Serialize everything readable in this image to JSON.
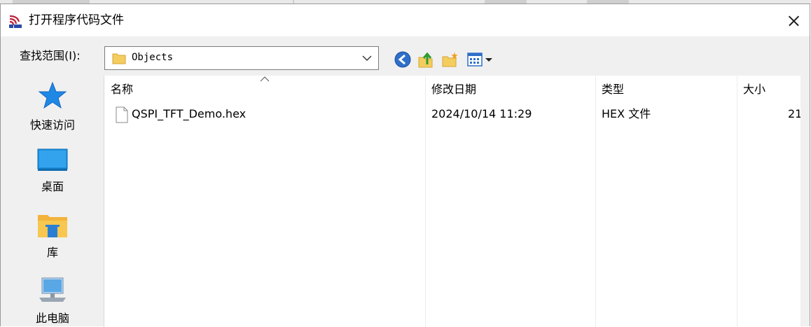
{
  "dialog": {
    "title": "打开程序代码文件"
  },
  "lookin": {
    "label": "查找范围(I):",
    "value": "Objects"
  },
  "toolbar": {
    "icons": [
      "back-icon",
      "up-folder-icon",
      "new-folder-icon",
      "view-menu-icon"
    ]
  },
  "places": [
    {
      "label": "快速访问",
      "icon": "star-icon"
    },
    {
      "label": "桌面",
      "icon": "desktop-icon"
    },
    {
      "label": "库",
      "icon": "library-icon"
    },
    {
      "label": "此电脑",
      "icon": "computer-icon"
    }
  ],
  "columns": {
    "name": "名称",
    "date": "修改日期",
    "type": "类型",
    "size": "大小"
  },
  "files": [
    {
      "name": "QSPI_TFT_Demo.hex",
      "date": "2024/10/14 11:29",
      "type": "HEX 文件",
      "size": "21"
    }
  ],
  "colors": {
    "accent": "#0078d7",
    "dialog_bg": "#f0f0f0",
    "list_bg": "#ffffff"
  }
}
